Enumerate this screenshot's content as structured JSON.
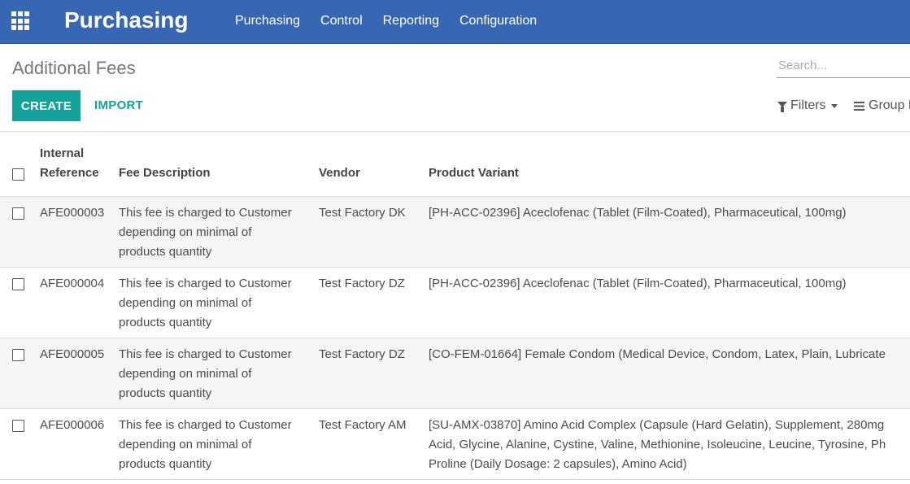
{
  "app": {
    "title": "Purchasing"
  },
  "menu": [
    "Purchasing",
    "Control",
    "Reporting",
    "Configuration"
  ],
  "page": {
    "title": "Additional Fees"
  },
  "search": {
    "placeholder": "Search..."
  },
  "buttons": {
    "create": "CREATE",
    "import": "IMPORT"
  },
  "search_options": {
    "filters": "Filters",
    "group_by": "Group By"
  },
  "table": {
    "columns": {
      "internal_reference": [
        "Internal",
        "Reference"
      ],
      "fee_description": "Fee Description",
      "vendor": "Vendor",
      "product_variant": "Product Variant"
    },
    "rows": [
      {
        "ref": "AFE000003",
        "desc": [
          "This fee is charged to Customer",
          "depending on minimal of",
          "products quantity"
        ],
        "vendor": "Test Factory DK",
        "product": [
          "[PH-ACC-02396] Aceclofenac (Tablet (Film-Coated), Pharmaceutical, 100mg)"
        ]
      },
      {
        "ref": "AFE000004",
        "desc": [
          "This fee is charged to Customer",
          "depending on minimal of",
          "products quantity"
        ],
        "vendor": "Test Factory DZ",
        "product": [
          "[PH-ACC-02396] Aceclofenac (Tablet (Film-Coated), Pharmaceutical, 100mg)"
        ]
      },
      {
        "ref": "AFE000005",
        "desc": [
          "This fee is charged to Customer",
          "depending on minimal of",
          "products quantity"
        ],
        "vendor": "Test Factory DZ",
        "product": [
          "[CO-FEM-01664] Female Condom (Medical Device, Condom, Latex, Plain, Lubricate"
        ]
      },
      {
        "ref": "AFE000006",
        "desc": [
          "This fee is charged to Customer",
          "depending on minimal of",
          "products quantity"
        ],
        "vendor": "Test Factory AM",
        "product": [
          "[SU-AMX-03870] Amino Acid Complex (Capsule (Hard Gelatin), Supplement, 280mg",
          "Acid, Glycine, Alanine, Cystine, Valine, Methionine, Isoleucine, Leucine, Tyrosine, Ph",
          "Proline (Daily Dosage: 2 capsules), Amino Acid)"
        ]
      }
    ]
  }
}
